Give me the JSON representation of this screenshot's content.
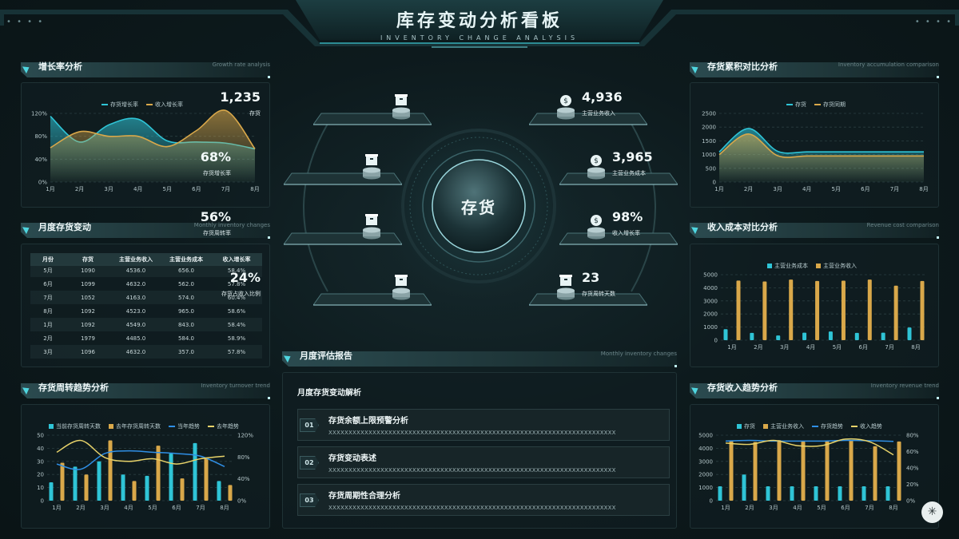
{
  "header": {
    "title": "库存变动分析看板",
    "subtitle": "INVENTORY CHANGE ANALYSIS",
    "dots": "• • • •"
  },
  "panels": {
    "growth": {
      "zh": "增长率分析",
      "en": "Growth rate analysis"
    },
    "monthly": {
      "zh": "月度存货变动",
      "en": "Monthly inventory changes"
    },
    "turnover": {
      "zh": "存货周转趋势分析",
      "en": "Inventory turnover trend"
    },
    "accum": {
      "zh": "存货累积对比分析",
      "en": "Inventory accumulation comparison"
    },
    "revcost": {
      "zh": "收入成本对比分析",
      "en": "Revenue cost comparison"
    },
    "revtrend": {
      "zh": "存货收入趋势分析",
      "en": "Inventory revenue trend"
    },
    "report": {
      "zh": "月度评估报告",
      "en": "Monthly inventory changes"
    }
  },
  "center": {
    "label": "存货",
    "stats_left": [
      {
        "value": "1,235",
        "label": "存货"
      },
      {
        "value": "68%",
        "label": "存货增长率"
      },
      {
        "value": "56%",
        "label": "存货周转率"
      },
      {
        "value": "24%",
        "label": "存货占收入比例"
      }
    ],
    "stats_right": [
      {
        "value": "4,936",
        "label": "主营业务收入"
      },
      {
        "value": "3,965",
        "label": "主营业务成本"
      },
      {
        "value": "98%",
        "label": "收入增长率"
      },
      {
        "value": "23",
        "label": "存货周转天数"
      }
    ]
  },
  "table": {
    "headers": [
      "月份",
      "存货",
      "主营业务收入",
      "主营业务成本",
      "收入增长率"
    ],
    "rows": [
      [
        "5月",
        "1090",
        "4536.0",
        "656.0",
        "58.4%"
      ],
      [
        "6月",
        "1099",
        "4632.0",
        "562.0",
        "57.8%"
      ],
      [
        "7月",
        "1052",
        "4163.0",
        "574.0",
        "60.4%"
      ],
      [
        "8月",
        "1092",
        "4523.0",
        "965.0",
        "58.6%"
      ],
      [
        "1月",
        "1092",
        "4549.0",
        "843.0",
        "58.4%"
      ],
      [
        "2月",
        "1979",
        "4485.0",
        "584.0",
        "58.9%"
      ],
      [
        "3月",
        "1096",
        "4632.0",
        "357.0",
        "57.8%"
      ]
    ]
  },
  "report": {
    "heading": "月度存货变动解析",
    "items": [
      {
        "no": "01",
        "title": "存货余额上限预警分析",
        "text": "XXXXXXXXXXXXXXXXXXXXXXXXXXXXXXXXXXXXXXXXXXXXXXXXXXXXXXXXXXXXXXXXXXXXXXXX"
      },
      {
        "no": "02",
        "title": "存货变动表述",
        "text": "XXXXXXXXXXXXXXXXXXXXXXXXXXXXXXXXXXXXXXXXXXXXXXXXXXXXXXXXXXXXXXXXXXXXXXXX"
      },
      {
        "no": "03",
        "title": "存货周期性合理分析",
        "text": "XXXXXXXXXXXXXXXXXXXXXXXXXXXXXXXXXXXXXXXXXXXXXXXXXXXXXXXXXXXXXXXXXXXXXXXX"
      }
    ]
  },
  "colors": {
    "cyan": "#2fc4d6",
    "gold": "#d9a84a",
    "bg": "#0b1619"
  },
  "chart_data": [
    {
      "id": "growth",
      "type": "area",
      "categories": [
        "1月",
        "2月",
        "3月",
        "4月",
        "5月",
        "6月",
        "7月",
        "8月"
      ],
      "series": [
        {
          "name": "存货增长率",
          "color": "#2fc4d6",
          "values": [
            115,
            70,
            100,
            110,
            72,
            70,
            68,
            58
          ]
        },
        {
          "name": "收入增长率",
          "color": "#d9a84a",
          "values": [
            60,
            88,
            80,
            80,
            62,
            90,
            125,
            58
          ]
        }
      ],
      "yticks": [
        "0%",
        "40%",
        "80%",
        "120%"
      ],
      "ylim": [
        0,
        120
      ]
    },
    {
      "id": "accum",
      "type": "area",
      "categories": [
        "1月",
        "2月",
        "3月",
        "4月",
        "5月",
        "6月",
        "7月",
        "8月"
      ],
      "series": [
        {
          "name": "存货",
          "color": "#2fc4d6",
          "values": [
            1100,
            1950,
            1120,
            1100,
            1100,
            1100,
            1100,
            1100
          ]
        },
        {
          "name": "存货同期",
          "color": "#d9a84a",
          "values": [
            1000,
            1750,
            960,
            950,
            950,
            950,
            950,
            950
          ]
        }
      ],
      "yticks": [
        "0",
        "500",
        "1000",
        "1500",
        "2000",
        "2500"
      ],
      "ylim": [
        0,
        2500
      ]
    },
    {
      "id": "revcost",
      "type": "bar",
      "categories": [
        "1月",
        "2月",
        "3月",
        "4月",
        "5月",
        "6月",
        "7月",
        "8月"
      ],
      "series": [
        {
          "name": "主营业务成本",
          "color": "#2fc4d6",
          "values": [
            840,
            560,
            360,
            570,
            660,
            560,
            570,
            970
          ]
        },
        {
          "name": "主营业务收入",
          "color": "#d9a84a",
          "values": [
            4550,
            4480,
            4630,
            4520,
            4540,
            4630,
            4160,
            4520
          ]
        }
      ],
      "yticks": [
        "0",
        "1000",
        "2000",
        "3000",
        "4000",
        "5000"
      ],
      "ylim": [
        0,
        5000
      ]
    },
    {
      "id": "turnover",
      "type": "bar",
      "categories": [
        "1月",
        "2月",
        "3月",
        "4月",
        "5月",
        "6月",
        "7月",
        "8月"
      ],
      "series": [
        {
          "name": "当前存货周转天数",
          "kind": "bar",
          "color": "#2fc4d6",
          "values": [
            14,
            26,
            30,
            20,
            19,
            36,
            44,
            15
          ]
        },
        {
          "name": "去年存货周转天数",
          "kind": "bar",
          "color": "#d9a84a",
          "values": [
            29,
            20,
            46,
            15,
            42,
            17,
            33,
            12
          ]
        },
        {
          "name": "当年趋势",
          "kind": "line",
          "color": "#2f8fe6",
          "values": [
            28,
            24,
            36,
            38,
            37,
            36,
            34,
            26
          ]
        },
        {
          "name": "去年趋势",
          "kind": "line",
          "color": "#e8d36a",
          "values": [
            37,
            46,
            33,
            30,
            32,
            28,
            32,
            34
          ]
        }
      ],
      "yticks_left": [
        "0",
        "10",
        "20",
        "30",
        "40",
        "50"
      ],
      "yticks_right": [
        "0%",
        "40%",
        "80%",
        "120%"
      ],
      "ylim": [
        0,
        50
      ]
    },
    {
      "id": "revtrend",
      "type": "bar",
      "categories": [
        "1月",
        "2月",
        "3月",
        "4月",
        "5月",
        "6月",
        "7月",
        "8月"
      ],
      "series": [
        {
          "name": "存货",
          "kind": "bar",
          "color": "#2fc4d6",
          "values": [
            1100,
            2000,
            1100,
            1100,
            1100,
            1100,
            1100,
            1100
          ]
        },
        {
          "name": "主营业务收入",
          "kind": "bar",
          "color": "#d9a84a",
          "values": [
            4550,
            4480,
            4630,
            4520,
            4540,
            4630,
            4160,
            4520
          ]
        },
        {
          "name": "存货趋势",
          "kind": "line",
          "color": "#2f8fe6",
          "values": [
            4550,
            4600,
            4550,
            4550,
            4550,
            4600,
            4580,
            4530
          ]
        },
        {
          "name": "收入趋势",
          "kind": "line",
          "color": "#e8d36a",
          "values": [
            4400,
            4300,
            4600,
            4200,
            4200,
            4700,
            4500,
            3500
          ]
        }
      ],
      "yticks_left": [
        "0",
        "1000",
        "2000",
        "3000",
        "4000",
        "5000"
      ],
      "yticks_right": [
        "0%",
        "20%",
        "40%",
        "60%",
        "80%"
      ],
      "ylim": [
        0,
        5000
      ]
    }
  ]
}
